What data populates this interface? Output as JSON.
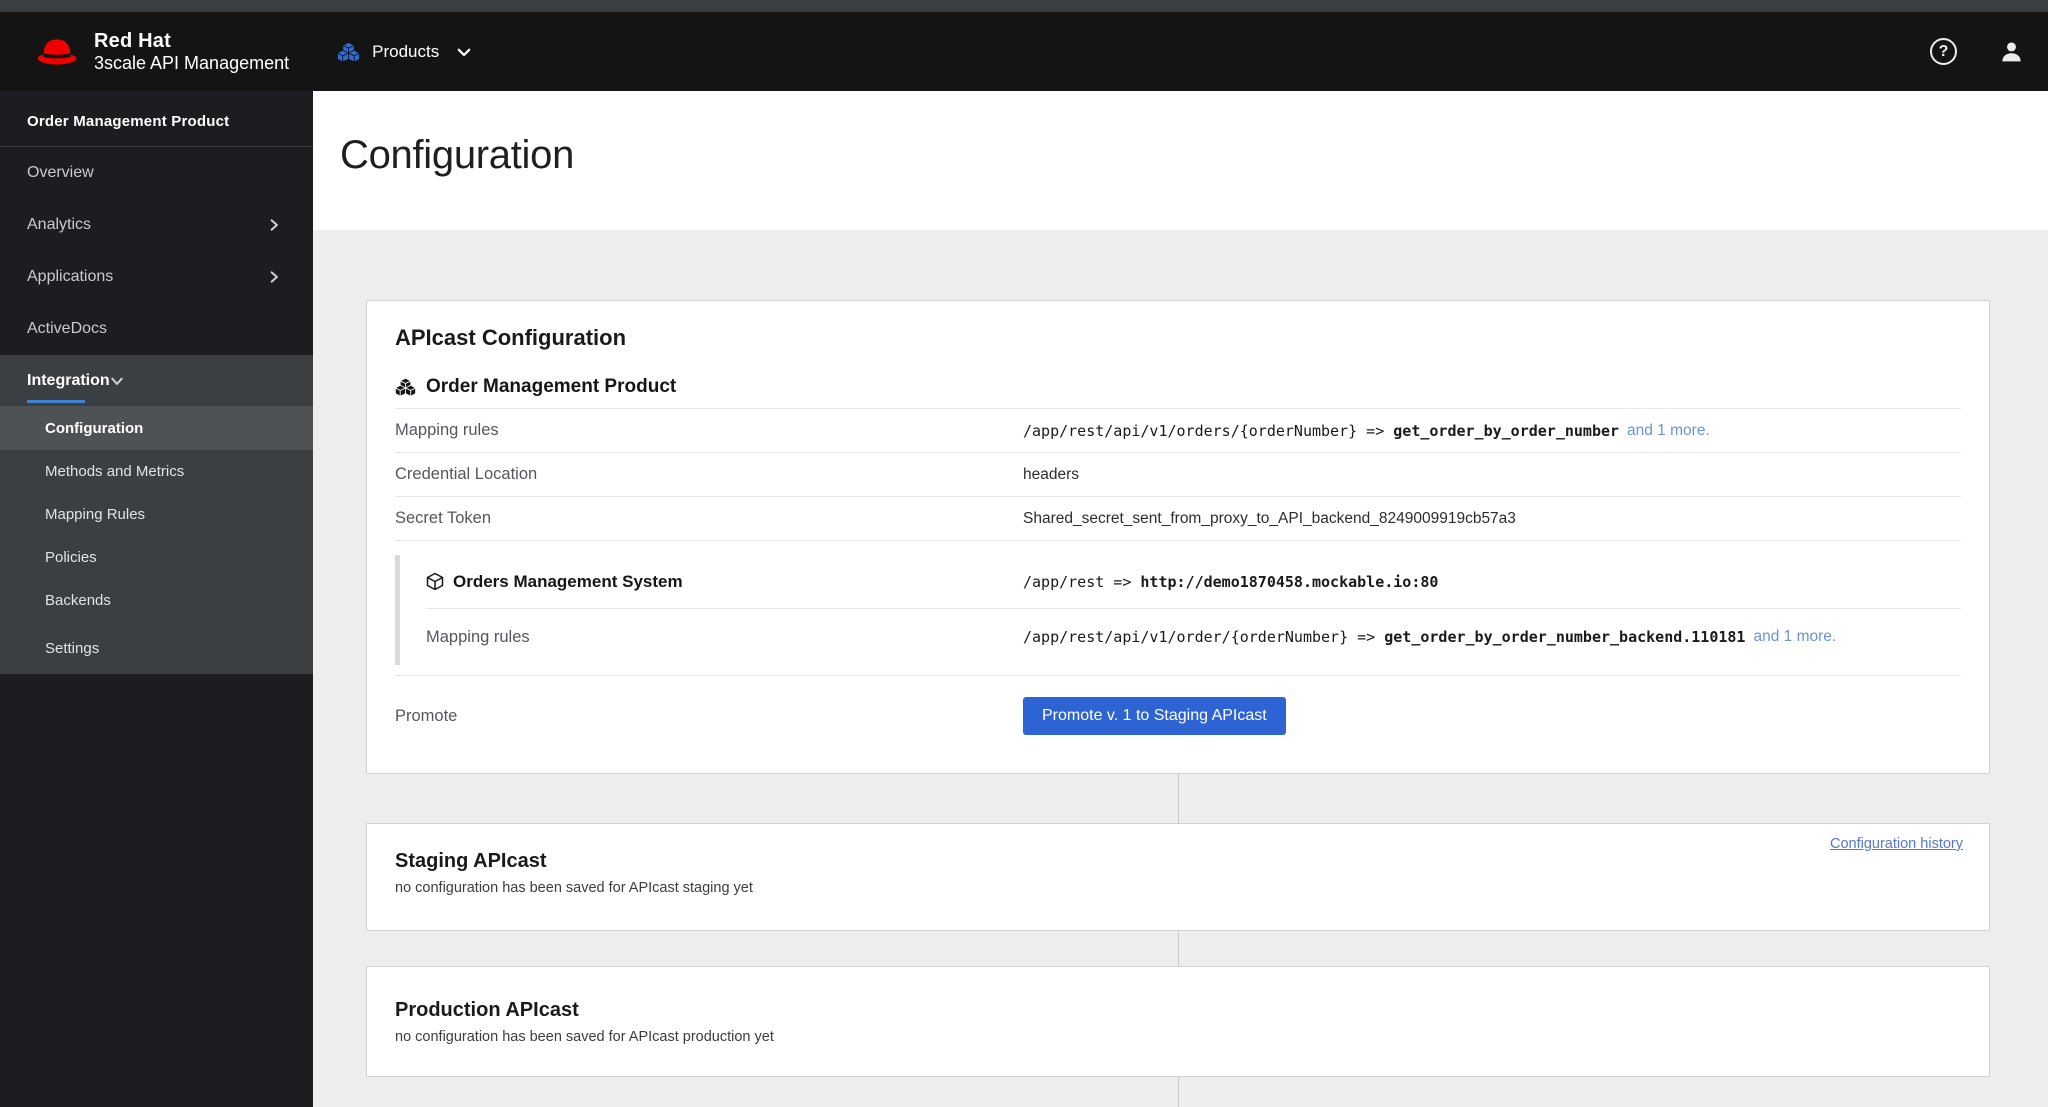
{
  "colors": {
    "header_bg": "#141414",
    "top_strip_gray": "#3c3f42",
    "sidebar_bg": "#1b1d21",
    "sidebar_expanded_bg": "#3c3f42",
    "sidebar_active_item_bg": "#4f5255",
    "sidebar_active_underline": "#3e82d8",
    "brand_red": "#ee0000",
    "products_icon_blue": "#2b6cd8",
    "promote_button_blue": "#2e63d4",
    "more_link_blue": "#6b93d9",
    "history_link_blue": "#5577d1",
    "content_bg": "#ededed"
  },
  "masthead": {
    "brand_line1": "Red Hat",
    "brand_line2": "3scale API Management",
    "products_label": "Products",
    "help_glyph": "?"
  },
  "sidebar": {
    "product_title": "Order Management Product",
    "items": [
      {
        "label": "Overview"
      },
      {
        "label": "Analytics"
      },
      {
        "label": "Applications"
      },
      {
        "label": "ActiveDocs"
      }
    ],
    "integration_label": "Integration",
    "submenu": [
      {
        "label": "Configuration"
      },
      {
        "label": "Methods and Metrics"
      },
      {
        "label": "Mapping Rules"
      },
      {
        "label": "Policies"
      },
      {
        "label": "Backends"
      },
      {
        "label": "Settings"
      }
    ]
  },
  "page": {
    "title": "Configuration"
  },
  "apicast": {
    "title": "APIcast Configuration",
    "product_name": "Order Management Product",
    "mapping_rules_label": "Mapping rules",
    "mapping_rule_path": "/app/rest/api/v1/orders/{orderNumber} => ",
    "mapping_rule_metric": "get_order_by_order_number",
    "mapping_rule_more": "and 1 more.",
    "credential_label": "Credential Location",
    "credential_value": "headers",
    "secret_label": "Secret Token",
    "secret_value": "Shared_secret_sent_from_proxy_to_API_backend_8249009919cb57a3",
    "backend": {
      "name": "Orders Management System",
      "endpoint_path": "/app/rest => ",
      "endpoint_target": "http://demo1870458.mockable.io:80",
      "mapping_rules_label": "Mapping rules",
      "mapping_rule_path": "/app/rest/api/v1/order/{orderNumber} => ",
      "mapping_rule_metric": "get_order_by_order_number_backend.110181",
      "mapping_rule_more": "and 1 more."
    },
    "promote_label": "Promote",
    "promote_button": "Promote v. 1 to Staging APIcast"
  },
  "staging": {
    "history_link": "Configuration history",
    "title": "Staging APIcast",
    "subtitle": "no configuration has been saved for APIcast staging yet"
  },
  "production": {
    "title": "Production APIcast",
    "subtitle": "no configuration has been saved for APIcast production yet"
  }
}
